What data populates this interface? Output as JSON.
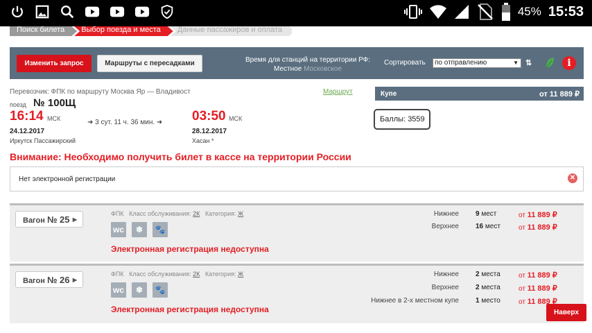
{
  "status_bar": {
    "battery_pct": "45%",
    "time": "15:53",
    "icons": [
      "power-icon",
      "image-icon",
      "search-icon",
      "youtube-icon",
      "youtube-icon",
      "youtube-icon",
      "shield-check-icon",
      "vibrate-icon",
      "wifi-icon",
      "signal-icon",
      "no-sim-icon",
      "battery-icon"
    ]
  },
  "steps": [
    {
      "label": "Поиск билета",
      "state": "done"
    },
    {
      "label": "Выбор поезда и места",
      "state": "active"
    },
    {
      "label": "Данные пассажиров и оплата",
      "state": "pending"
    }
  ],
  "toolbar": {
    "change_request": "Изменить запрос",
    "transfer_routes": "Маршруты с пересадками",
    "tz_title": "Время для станций на территории РФ:",
    "tz_local": "Местное",
    "tz_moscow": "Московское",
    "sort_label": "Сортировать",
    "sort_value": "по отправлению",
    "sort_order_icon": "⇅"
  },
  "train": {
    "carrier_line": "Перевозчик: ФПК   по маршруту Москва Яр — Владивост",
    "route_link": "Маршрут",
    "number_label": "поезд",
    "number": "№ 100Щ",
    "dep_time": "16:14",
    "dep_tz": "МСК",
    "duration": "➜ 3 сут. 11 ч. 36 мин. ➜",
    "arr_time": "03:50",
    "arr_tz": "МСК",
    "dep_date": "24.12.2017",
    "dep_station": "Иркутск Пассажирский",
    "arr_date": "28.12.2017",
    "arr_station": "Хасан *"
  },
  "class_bar": {
    "name": "Купе",
    "price": "от 11 889 ₽"
  },
  "points": "Баллы: 3559",
  "warning": "Внимание: Необходимо получить билет в кассе на территории России",
  "no_registration": "Нет электронной регистрации",
  "wagons": [
    {
      "label": "Вагон",
      "number": "№ 25",
      "carrier": "ФПК",
      "class_label": "Класс обслуживания:",
      "class_value": "2К",
      "category_label": "Категория:",
      "category_value": "Ж",
      "unavailable": "Электронная регистрация недоступна",
      "seats": [
        {
          "type": "Нижнее",
          "count": "9",
          "unit": "мест",
          "price_prefix": "от",
          "price": "11 889 ₽"
        },
        {
          "type": "Верхнее",
          "count": "16",
          "unit": "мест",
          "price_prefix": "от",
          "price": "11 889 ₽"
        }
      ]
    },
    {
      "label": "Вагон",
      "number": "№ 26",
      "carrier": "ФПК",
      "class_label": "Класс обслуживания:",
      "class_value": "2К",
      "category_label": "Категория:",
      "category_value": "Ж",
      "unavailable": "Электронная регистрация недоступна",
      "seats": [
        {
          "type": "Нижнее",
          "count": "2",
          "unit": "места",
          "price_prefix": "от",
          "price": "11 889 ₽"
        },
        {
          "type": "Верхнее",
          "count": "2",
          "unit": "места",
          "price_prefix": "от",
          "price": "11 889 ₽"
        },
        {
          "type": "Нижнее в 2-х местном купе",
          "count": "1",
          "unit": "место",
          "price_prefix": "от",
          "price": "11 889 ₽"
        }
      ]
    }
  ],
  "back_to_top": "Наверх",
  "colors": {
    "accent": "#e31e24",
    "toolbar": "#5a6e7f",
    "button_red": "#d7121b"
  }
}
